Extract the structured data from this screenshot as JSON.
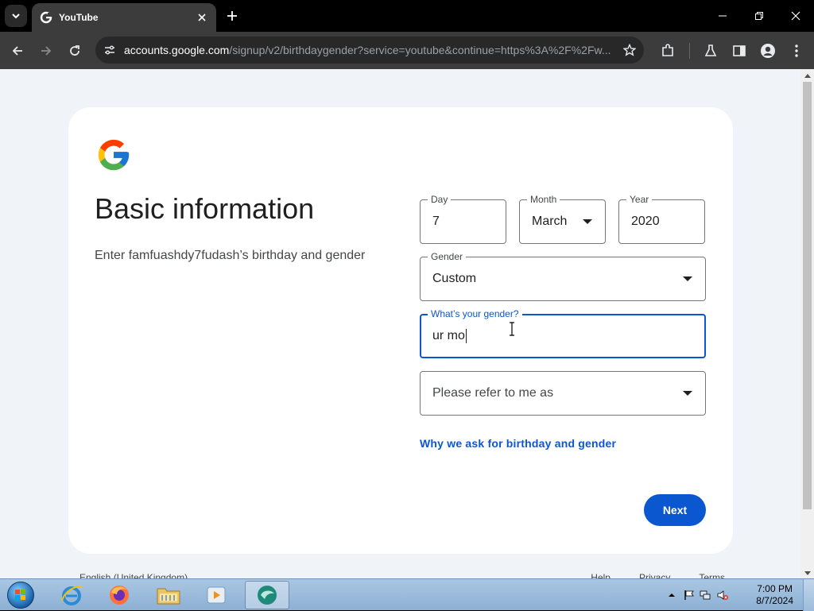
{
  "browser": {
    "tab_title": "YouTube",
    "url_host": "accounts.google.com",
    "url_path": "/signup/v2/birthdaygender?service=youtube&continue=https%3A%2F%2Fw..."
  },
  "page": {
    "heading": "Basic information",
    "subtext": "Enter famfuashdy7fudash’s birthday and gender",
    "day": {
      "label": "Day",
      "value": "7"
    },
    "month": {
      "label": "Month",
      "value": "March"
    },
    "year": {
      "label": "Year",
      "value": "2020"
    },
    "gender": {
      "label": "Gender",
      "value": "Custom"
    },
    "custom_gender": {
      "label": "What’s your gender?",
      "value": "ur mo"
    },
    "pronoun": {
      "placeholder": "Please refer to me as"
    },
    "why_link": "Why we ask for birthday and gender",
    "next_button": "Next"
  },
  "footer": {
    "language": "English (United Kingdom)",
    "links": [
      "Help",
      "Privacy",
      "Terms"
    ]
  },
  "taskbar": {
    "time": "7:00 PM",
    "date": "8/7/2024"
  },
  "colors": {
    "accent": "#0b57d0",
    "page_bg": "#f0f4f9"
  }
}
